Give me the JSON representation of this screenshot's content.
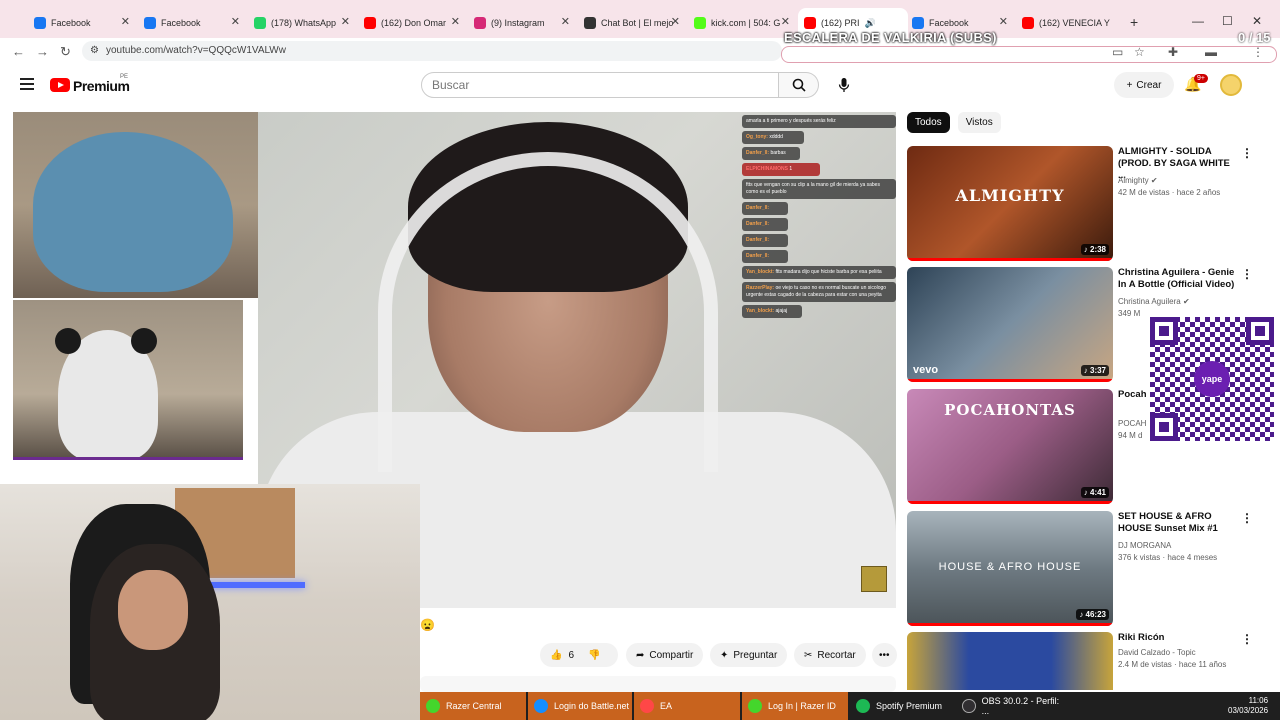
{
  "browser": {
    "tabs": [
      {
        "label": "Facebook",
        "color": "#1877f2"
      },
      {
        "label": "Facebook",
        "color": "#1877f2"
      },
      {
        "label": "(178) WhatsApp",
        "color": "#25d366"
      },
      {
        "label": "(162) Don Omar",
        "color": "#ff0000"
      },
      {
        "label": "(9) Instagram",
        "color": "#d62976"
      },
      {
        "label": "Chat Bot | El mejo",
        "color": "#333333"
      },
      {
        "label": "kick.com | 504: G",
        "color": "#53fc18"
      },
      {
        "label": "(162) PRI",
        "color": "#ff0000"
      },
      {
        "label": "Facebook",
        "color": "#1877f2"
      },
      {
        "label": "(162) VENECIA Y",
        "color": "#ff0000"
      }
    ],
    "url": "youtube.com/watch?v=QQQcW1VALWw"
  },
  "overlay": {
    "title": "ESCALERA DE VALKIRIA (SUBS)",
    "counter": "0 / 15"
  },
  "youtube": {
    "brand": "Premium",
    "region": "PE",
    "search_placeholder": "Buscar",
    "create_label": "Crear",
    "notifications": "9+"
  },
  "chat": [
    {
      "user": "",
      "text": "amarla a ti primero y después serás feliz"
    },
    {
      "user": "Og_tony:",
      "text": "xdddd"
    },
    {
      "user": "Danfer_ll:",
      "text": "barbas"
    },
    {
      "user": "ELPICHINAMONS",
      "text": "1"
    },
    {
      "user": "",
      "text": "ftts que vengan con su clip a la mano gil de mierda ya sabes como es el pueblo"
    },
    {
      "user": "Danfer_ll:",
      "text": ""
    },
    {
      "user": "Danfer_ll:",
      "text": ""
    },
    {
      "user": "Danfer_ll:",
      "text": ""
    },
    {
      "user": "Danfer_ll:",
      "text": ""
    },
    {
      "user": "Yan_blockt:",
      "text": "ftts madara dijo que hiciste barba por esa peliita"
    },
    {
      "user": "RazzerPlay:",
      "text": "oe viejo tu caso no es normal buscate un sicologo urgente estas cagado de la cabeza para estar con una peyita"
    },
    {
      "user": "Yan_blockt:",
      "text": "ajajaj"
    }
  ],
  "actions": {
    "likes": "6",
    "share": "Compartir",
    "ask": "Preguntar",
    "clip": "Recortar"
  },
  "sidebar": {
    "chips": [
      "Todos",
      "Vistos"
    ],
    "recommendations": [
      {
        "title": "ALMIGHTY - SOLIDA (PROD. BY SAGA WHITE ...",
        "channel": "Almighty",
        "meta": "42 M de vistas · hace 2 años",
        "duration": "♪ 2:38",
        "thumb_text": "ALMIGHTY",
        "thumb_color": "#8b3a1c"
      },
      {
        "title": "Christina Aguilera - Genie In A Bottle (Official Video)",
        "channel": "Christina Aguilera",
        "meta": "349 M",
        "duration": "♪ 3:37",
        "thumb_text": "",
        "thumb_color": "#3e5468"
      },
      {
        "title": "Pocah (Clipe",
        "channel": "POCAH",
        "meta": "94 M d",
        "duration": "♪ 4:41",
        "thumb_text": "POCAHONTAS",
        "thumb_color": "#b56aa0"
      },
      {
        "title": "SET HOUSE & AFRO HOUSE Sunset Mix #1",
        "channel": "DJ MORGANA",
        "meta": "376 k vistas · hace 4 meses",
        "duration": "♪ 46:23",
        "thumb_text": "HOUSE & AFRO HOUSE",
        "thumb_color": "#7d8a94"
      },
      {
        "title": "Riki Ricón",
        "channel": "David Calzado - Topic",
        "meta": "2.4 M de vistas · hace 11 años",
        "duration": "",
        "thumb_text": "",
        "thumb_color": "#2b4aa0"
      }
    ],
    "vevo": "vevo",
    "qr_label": "yape"
  },
  "taskbar": {
    "items": [
      {
        "label": "Razer Central",
        "color": "#44d62c"
      },
      {
        "label": "Login do Battle.net",
        "color": "#148eff"
      },
      {
        "label": "EA",
        "color": "#ff4747"
      },
      {
        "label": "Log In | Razer ID",
        "color": "#44d62c"
      },
      {
        "label": "Spotify Premium",
        "color": "#1db954"
      },
      {
        "label": "OBS 30.0.2 - Perfil: ...",
        "color": "#302e31"
      }
    ],
    "time": "11:06",
    "date": "03/03/2026"
  }
}
